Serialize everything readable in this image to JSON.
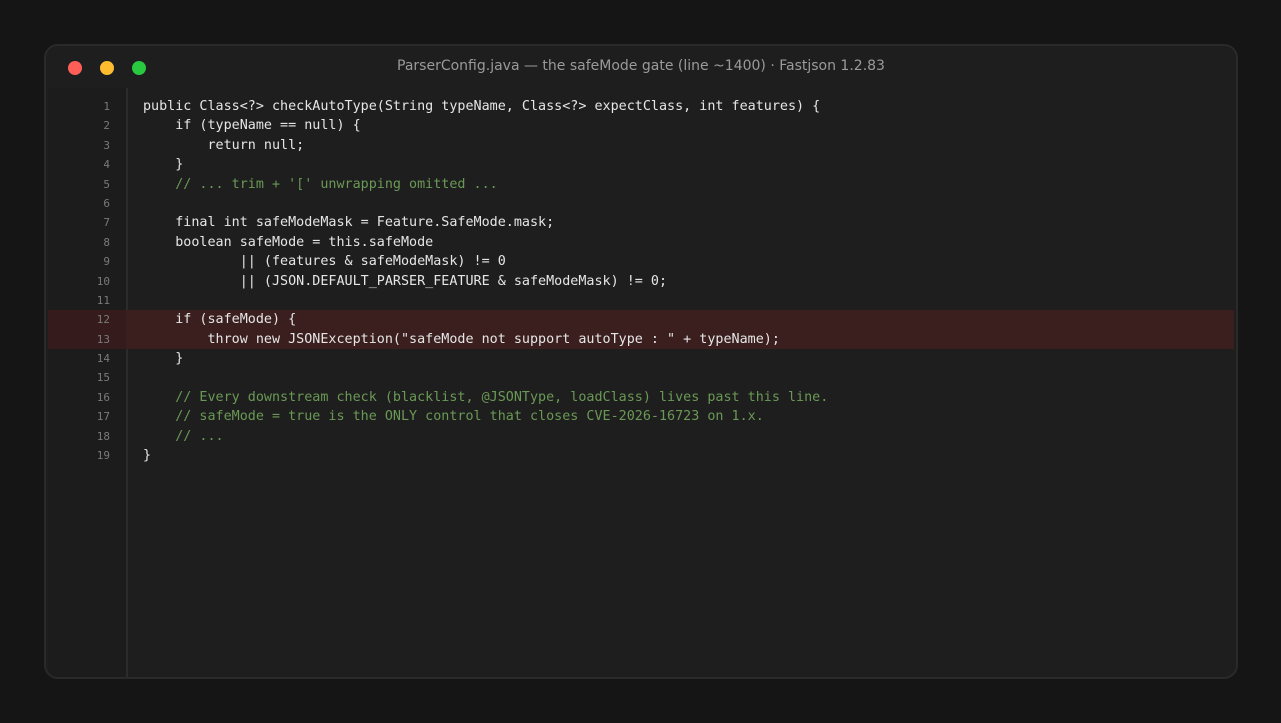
{
  "window": {
    "title": "ParserConfig.java  —  the safeMode gate (line ~1400)  ·  Fastjson 1.2.83"
  },
  "code": {
    "highlighted_lines": [
      12,
      13
    ],
    "lines": [
      {
        "num": "1",
        "text": "public Class<?> checkAutoType(String typeName, Class<?> expectClass, int features) {",
        "kind": "code"
      },
      {
        "num": "2",
        "text": "    if (typeName == null) {",
        "kind": "code"
      },
      {
        "num": "3",
        "text": "        return null;",
        "kind": "code"
      },
      {
        "num": "4",
        "text": "    }",
        "kind": "code"
      },
      {
        "num": "5",
        "text": "    // ... trim + '[' unwrapping omitted ...",
        "kind": "comment"
      },
      {
        "num": "6",
        "text": "",
        "kind": "code"
      },
      {
        "num": "7",
        "text": "    final int safeModeMask = Feature.SafeMode.mask;",
        "kind": "code"
      },
      {
        "num": "8",
        "text": "    boolean safeMode = this.safeMode",
        "kind": "code"
      },
      {
        "num": "9",
        "text": "            || (features & safeModeMask) != 0",
        "kind": "code"
      },
      {
        "num": "10",
        "text": "            || (JSON.DEFAULT_PARSER_FEATURE & safeModeMask) != 0;",
        "kind": "code"
      },
      {
        "num": "11",
        "text": "",
        "kind": "code"
      },
      {
        "num": "12",
        "text": "    if (safeMode) {",
        "kind": "code"
      },
      {
        "num": "13",
        "text": "        throw new JSONException(\"safeMode not support autoType : \" + typeName);",
        "kind": "code"
      },
      {
        "num": "14",
        "text": "    }",
        "kind": "code"
      },
      {
        "num": "15",
        "text": "",
        "kind": "code"
      },
      {
        "num": "16",
        "text": "    // Every downstream check (blacklist, @JSONType, loadClass) lives past this line.",
        "kind": "comment"
      },
      {
        "num": "17",
        "text": "    // safeMode = true is the ONLY control that closes CVE-2026-16723 on 1.x.",
        "kind": "comment"
      },
      {
        "num": "18",
        "text": "    // ...",
        "kind": "comment"
      },
      {
        "num": "19",
        "text": "}",
        "kind": "code"
      }
    ]
  },
  "colors": {
    "background": "#151515",
    "window": "#1e1e1e",
    "code_text": "#e6e6e6",
    "comment": "#6a9955",
    "highlight": "#3b1e1e",
    "close": "#ff5f57",
    "minimize": "#febc2e",
    "maximize": "#28c840"
  }
}
